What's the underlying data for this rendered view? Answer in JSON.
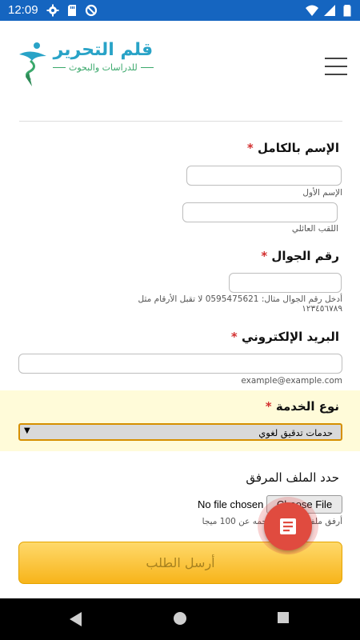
{
  "status_bar": {
    "time": "12:09",
    "icons": [
      "gear-icon",
      "sd-card-icon",
      "data-saver-icon",
      "wifi-icon",
      "signal-icon",
      "battery-icon"
    ],
    "color": "#1565c0"
  },
  "header": {
    "logo_title": "قلم التحرير",
    "logo_subtitle": "للدراسات والبحوث",
    "menu_icon": "hamburger-icon"
  },
  "form": {
    "full_name": {
      "label": "الإسم بالكامل",
      "required_mark": "*",
      "first_name_hint": "الإسم الأول",
      "last_name_hint": "اللقب العائلي",
      "first_name_value": "",
      "last_name_value": ""
    },
    "phone": {
      "label": "رقم الجوال",
      "required_mark": "*",
      "value": "",
      "hint_line1": "أدخل رقم الجوال مثال: 0595475621 لا تقبل الأرقام مثل",
      "hint_line2": "١٢٣٤٥٦٧٨٩"
    },
    "email": {
      "label": "البريد الإلكتروني",
      "required_mark": "*",
      "value": "",
      "hint": "example@example.com"
    },
    "service": {
      "label": "نوع الخدمة",
      "required_mark": "*",
      "selected": "حدمات تدقيق لغوي",
      "highlight_color": "#fffbd9"
    },
    "attachment": {
      "label": "حدد الملف المرفق",
      "button_label": "Choose File",
      "status": "No file chosen",
      "hint": "أرفق ملف لا يتجاوز حجمه عن 100 ميجا"
    },
    "submit_label": "أرسل الطلب"
  },
  "fab": {
    "icon": "form-document-icon",
    "color": "#e04b3f"
  },
  "nav_bar": {
    "icons": [
      "back-icon",
      "home-icon",
      "recents-icon"
    ]
  }
}
